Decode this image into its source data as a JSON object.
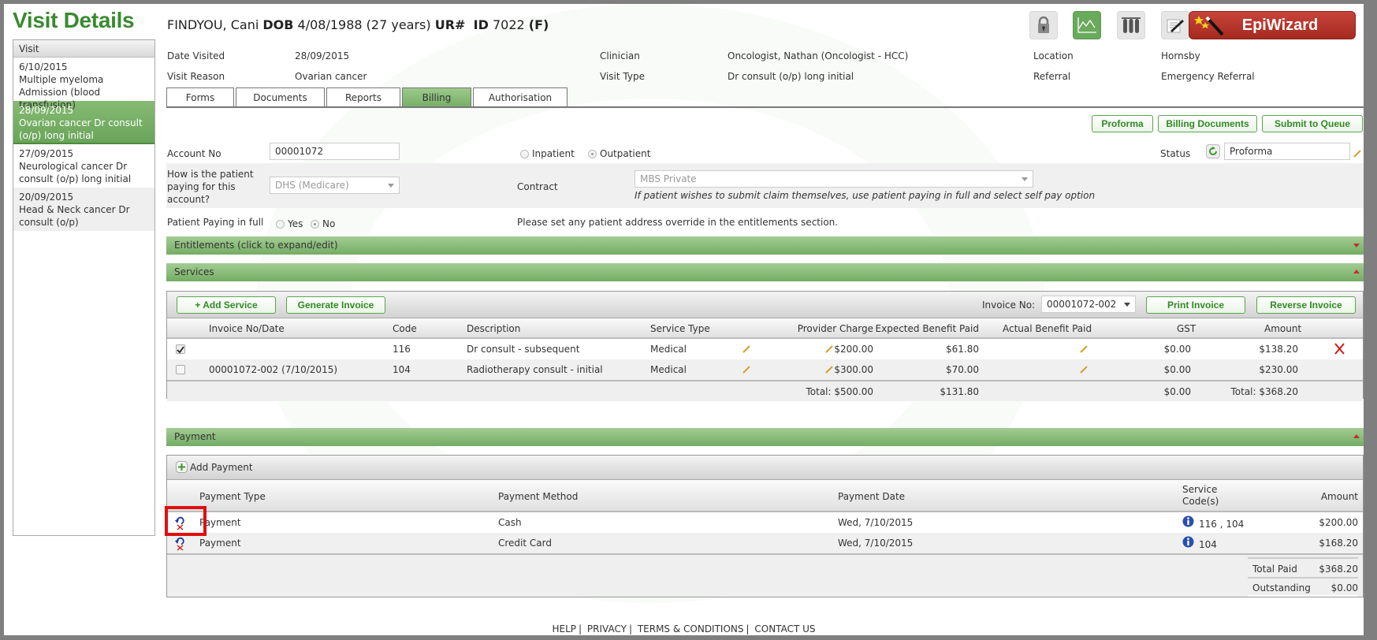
{
  "page": {
    "title": "Visit Details",
    "patient": {
      "name": "FINDYOU, Cani",
      "dob_label": "DOB",
      "dob": "4/08/1988 (27 years)",
      "ur_label": "UR#",
      "id_label": "ID",
      "id": "7022",
      "sex": "(F)"
    }
  },
  "toolbar_icons": [
    {
      "name": "lock-icon"
    },
    {
      "name": "chart-icon",
      "active": true
    },
    {
      "name": "test-tubes-icon"
    },
    {
      "name": "notes-icon"
    }
  ],
  "epiwizard": {
    "label": "EpiWizard"
  },
  "sidebar": {
    "header": "Visit",
    "items": [
      {
        "date": "6/10/2015",
        "desc": "Multiple myeloma   Admission (blood transfusion)",
        "selected": false
      },
      {
        "date": "28/09/2015",
        "desc": "Ovarian cancer   Dr consult (o/p) long initial",
        "selected": true
      },
      {
        "date": "27/09/2015",
        "desc": "Neurological cancer   Dr consult (o/p) long initial",
        "selected": false
      },
      {
        "date": "20/09/2015",
        "desc": "Head & Neck cancer   Dr consult (o/p)",
        "selected": false
      }
    ]
  },
  "visit_info": {
    "date_visited_label": "Date Visited",
    "date_visited": "28/09/2015",
    "visit_reason_label": "Visit Reason",
    "visit_reason": "Ovarian cancer",
    "clinician_label": "Clinician",
    "clinician": "Oncologist, Nathan (Oncologist - HCC)",
    "visit_type_label": "Visit Type",
    "visit_type": "Dr consult (o/p) long initial",
    "location_label": "Location",
    "location": "Hornsby",
    "referral_label": "Referral",
    "referral": "Emergency Referral"
  },
  "tabs": [
    {
      "label": "Forms",
      "active": false
    },
    {
      "label": "Documents",
      "active": false
    },
    {
      "label": "Reports",
      "active": false
    },
    {
      "label": "Billing",
      "active": true
    },
    {
      "label": "Authorisation",
      "active": false
    }
  ],
  "actions": {
    "proforma": "Proforma",
    "billing_documents": "Billing Documents",
    "submit_to_queue": "Submit to Queue"
  },
  "account": {
    "account_no_label": "Account No",
    "account_no": "00001072",
    "inpatient_label": "Inpatient",
    "outpatient_label": "Outpatient",
    "patient_class": "Outpatient",
    "status_label": "Status",
    "status": "Proforma",
    "paying_label": "How is the patient paying for this account?",
    "paying_value": "DHS (Medicare)",
    "contract_label": "Contract",
    "contract_value": "MBS Private",
    "contract_hint": "If patient wishes to submit claim themselves, use patient paying in full and select self pay option",
    "paying_full_label": "Patient Paying in full",
    "yes_label": "Yes",
    "no_label": "No",
    "paying_full": "No",
    "address_note": "Please set any patient address override in the entitlements section."
  },
  "sections": {
    "entitlements": "Entitlements (click to expand/edit)",
    "services": "Services",
    "payment": "Payment"
  },
  "services": {
    "add_service": "+ Add Service",
    "generate_invoice": "Generate Invoice",
    "invoice_no_label": "Invoice No:",
    "invoice_no": "00001072-002",
    "print_invoice": "Print Invoice",
    "reverse_invoice": "Reverse Invoice",
    "columns": [
      "Invoice No/Date",
      "Code",
      "Description",
      "Service Type",
      "Provider Charge",
      "Expected Benefit Paid",
      "Actual Benefit Paid",
      "GST",
      "Amount"
    ],
    "rows": [
      {
        "checked": true,
        "invoice": "",
        "code": "116",
        "description": "Dr consult - subsequent",
        "service_type": "Medical",
        "provider_charge": "$200.00",
        "expected_benefit": "$61.80",
        "actual_benefit": "",
        "gst": "$0.00",
        "amount": "$138.20",
        "deletable": true
      },
      {
        "checked": false,
        "invoice": "00001072-002 (7/10/2015)",
        "code": "104",
        "description": "Radiotherapy consult - initial",
        "service_type": "Medical",
        "provider_charge": "$300.00",
        "expected_benefit": "$70.00",
        "actual_benefit": "",
        "gst": "$0.00",
        "amount": "$230.00",
        "deletable": false
      }
    ],
    "totals": {
      "provider_charge": "Total: $500.00",
      "expected_benefit": "$131.80",
      "gst": "$0.00",
      "amount": "Total: $368.20"
    }
  },
  "payment": {
    "add_payment": "Add Payment",
    "columns": [
      "Payment Type",
      "Payment Method",
      "Payment Date",
      "Service Code(s)",
      "Amount"
    ],
    "rows": [
      {
        "type": "Payment",
        "method": "Cash",
        "date": "Wed, 7/10/2015",
        "codes": "116 , 104",
        "amount": "$200.00"
      },
      {
        "type": "Payment",
        "method": "Credit Card",
        "date": "Wed, 7/10/2015",
        "codes": "104",
        "amount": "$168.20"
      }
    ],
    "total_paid_label": "Total Paid",
    "total_paid": "$368.20",
    "outstanding_label": "Outstanding",
    "outstanding": "$0.00"
  },
  "footer": {
    "links": [
      "HELP",
      "PRIVACY",
      "TERMS & CONDITIONS",
      "CONTACT US"
    ]
  }
}
